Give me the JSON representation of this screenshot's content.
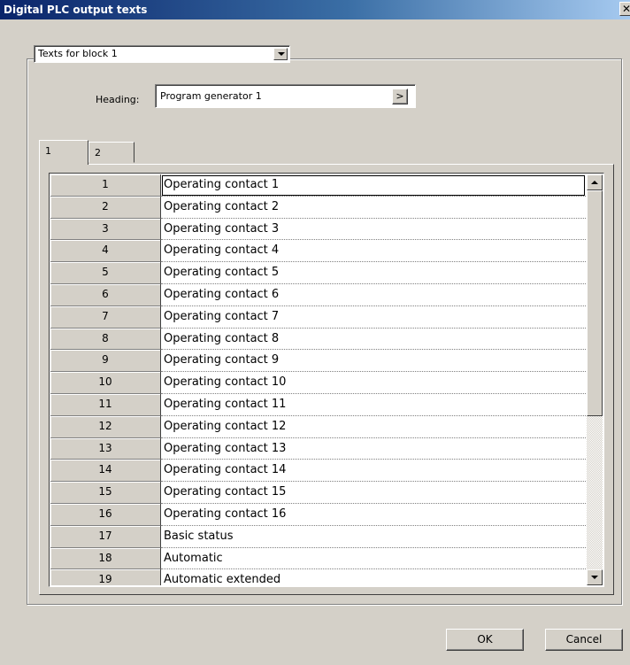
{
  "window": {
    "title": "Digital PLC output texts"
  },
  "block_select": {
    "value": "Texts for block 1"
  },
  "heading": {
    "label": "Heading:",
    "value": "Program generator 1",
    "browse_label": ">"
  },
  "tabs": [
    {
      "label": "1"
    },
    {
      "label": "2"
    }
  ],
  "rows": [
    {
      "num": "1",
      "text": "Operating contact 1"
    },
    {
      "num": "2",
      "text": "Operating contact 2"
    },
    {
      "num": "3",
      "text": "Operating contact 3"
    },
    {
      "num": "4",
      "text": "Operating contact 4"
    },
    {
      "num": "5",
      "text": "Operating contact 5"
    },
    {
      "num": "6",
      "text": "Operating contact 6"
    },
    {
      "num": "7",
      "text": "Operating contact 7"
    },
    {
      "num": "8",
      "text": "Operating contact 8"
    },
    {
      "num": "9",
      "text": "Operating contact 9"
    },
    {
      "num": "10",
      "text": "Operating contact 10"
    },
    {
      "num": "11",
      "text": "Operating contact 11"
    },
    {
      "num": "12",
      "text": "Operating contact 12"
    },
    {
      "num": "13",
      "text": "Operating contact 13"
    },
    {
      "num": "14",
      "text": "Operating contact 14"
    },
    {
      "num": "15",
      "text": "Operating contact 15"
    },
    {
      "num": "16",
      "text": "Operating contact 16"
    },
    {
      "num": "17",
      "text": "Basic status"
    },
    {
      "num": "18",
      "text": "Automatic"
    },
    {
      "num": "19",
      "text": "Automatic extended"
    }
  ],
  "buttons": {
    "ok": "OK",
    "cancel": "Cancel"
  }
}
